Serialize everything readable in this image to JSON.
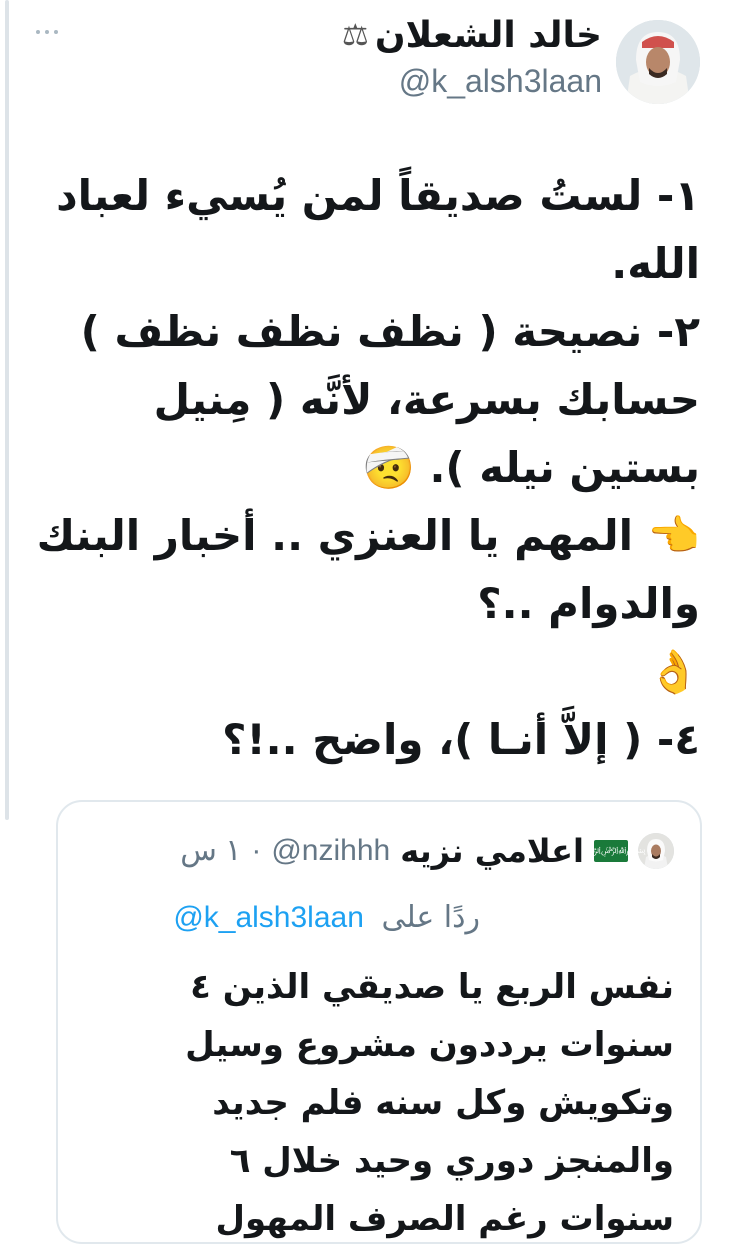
{
  "tweet": {
    "author": {
      "display_name": "خالد الشعلان",
      "badge_icon": "scales-icon",
      "handle": "@k_alsh3laan"
    },
    "more_icon": "more-horizontal-icon",
    "body_lines": [
      "١- لستُ صديقاً لمن يُسيء لعباد",
      "الله.",
      "٢- نصيحة ( نظف نظف نظف )",
      "حسابك بسرعة، لأنَّه ( مِنيل",
      "بستين نيله ). 🤕",
      "👈 المهم يا العنزي .. أخبار البنك",
      "والدوام ..؟",
      "👌",
      "٤- ( إلاَّ أنـا )، واضح ..!؟"
    ]
  },
  "quoted_tweet": {
    "display_name": "اعلامي نزيه",
    "flag_icon": "saudi-flag-icon",
    "handle": "@nzihhh",
    "separator": "·",
    "time": "١ س",
    "reply_label": "ردًا على",
    "reply_handle": "@k_alsh3laan",
    "body_lines": [
      "نفس الربع يا صديقي الذين ٤",
      "سنوات يرددون مشروع وسيل",
      "وتكويش وكل سنه فلم جديد",
      "والمنجز دوري وحيد خلال ٦",
      "سنوات رغم الصرف المهول"
    ]
  },
  "colors": {
    "text": "#14171a",
    "secondary": "#657786",
    "link": "#1da1f2",
    "border": "#e1e8ed"
  }
}
